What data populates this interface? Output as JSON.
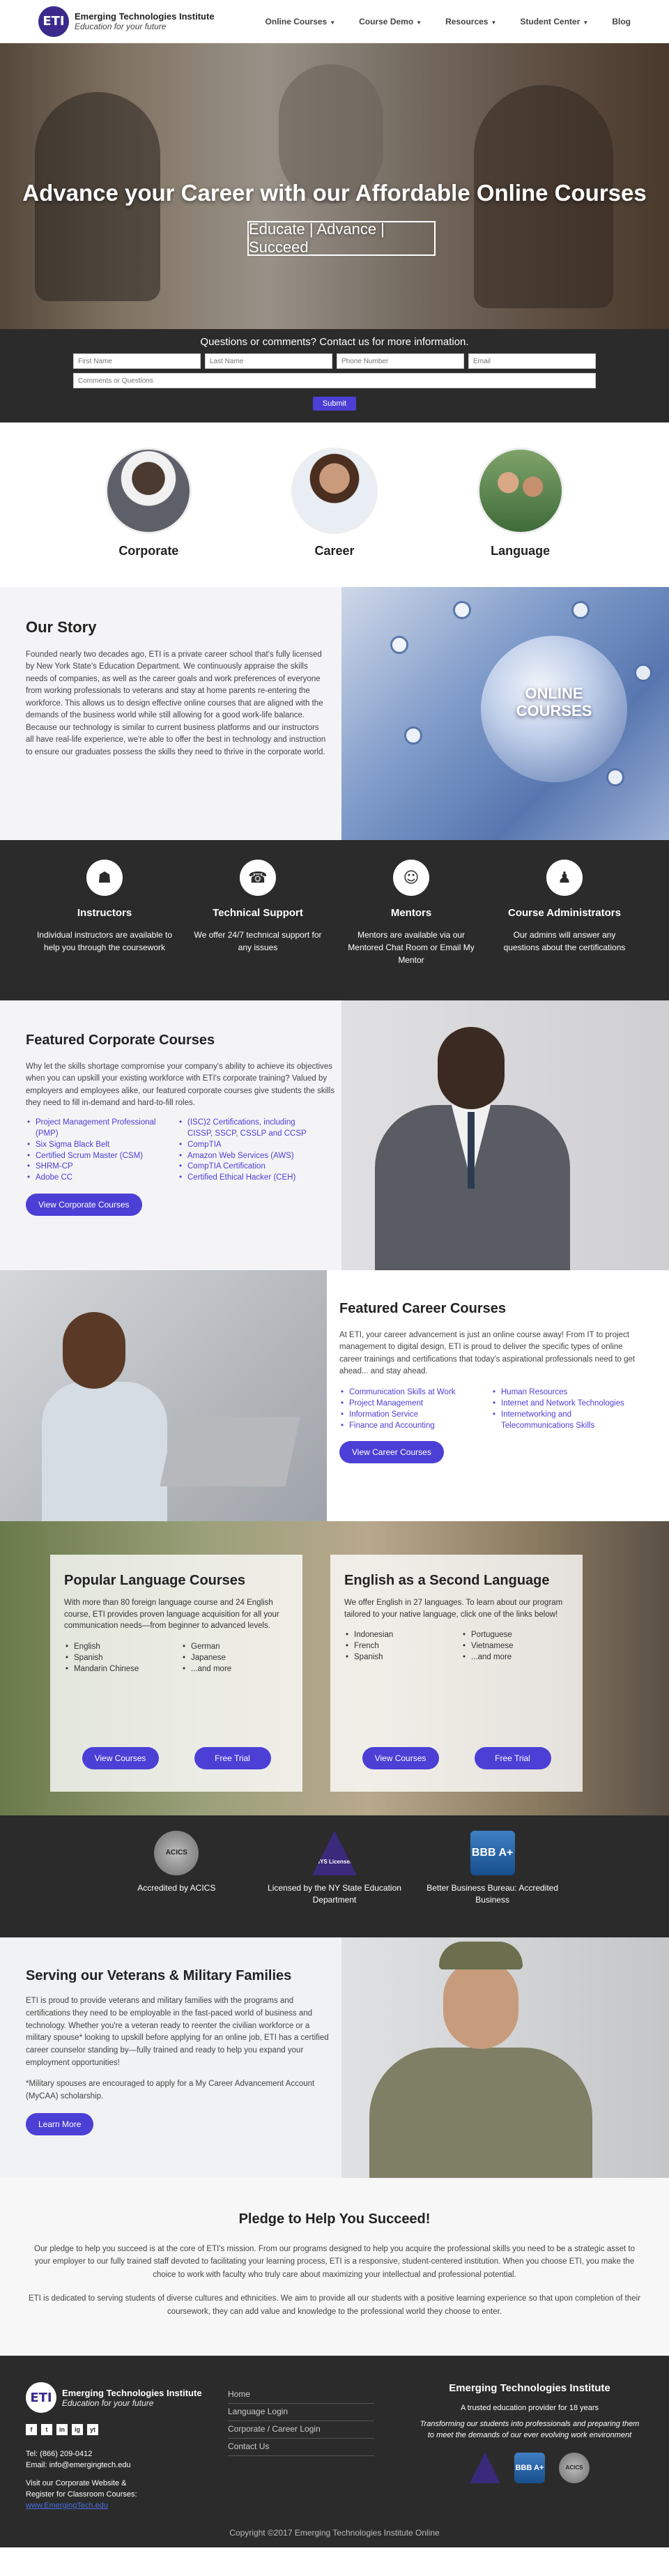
{
  "brand": {
    "name": "Emerging Technologies Institute",
    "tagline": "Education for your future",
    "logo_letters": "ETI"
  },
  "nav": {
    "items": [
      "Online Courses",
      "Course Demo",
      "Resources",
      "Student Center",
      "Blog"
    ]
  },
  "hero": {
    "title": "Advance your Career with our Affordable Online Courses",
    "subtitle": "Educate | Advance | Succeed"
  },
  "contact": {
    "heading": "Questions or comments? Contact us for more information.",
    "placeholders": {
      "first_name": "First Name",
      "last_name": "Last Name",
      "phone": "Phone Number",
      "email": "Email",
      "questions": "Comments or Questions"
    },
    "submit_label": "Submit"
  },
  "categories": [
    {
      "label": "Corporate"
    },
    {
      "label": "Career"
    },
    {
      "label": "Language"
    }
  ],
  "story": {
    "heading": "Our Story",
    "body": "Founded nearly two decades ago, ETI is a private career school that's fully licensed by New York State's Education Department. We continuously appraise the skills needs of companies, as well as the career goals and work preferences of everyone from working professionals to veterans and stay at home parents re-entering the workforce. This allows us to design effective online courses that are aligned with the demands of the business world while still allowing for a good work-life balance. Because our technology is similar to current business platforms and our instructors all have real-life experience, we're able to offer the best in technology and instruction to ensure our graduates possess the skills they need to thrive in the corporate world.",
    "image_text_1": "ONLINE",
    "image_text_2": "COURSES"
  },
  "support": [
    {
      "title": "Instructors",
      "text": "Individual instructors are available to help you through the coursework",
      "icon": "teacher-icon"
    },
    {
      "title": "Technical Support",
      "text": "We offer 24/7 technical support for any issues",
      "icon": "headset-icon"
    },
    {
      "title": "Mentors",
      "text": "Mentors are available via our Mentored Chat Room or Email My Mentor",
      "icon": "mentor-icon"
    },
    {
      "title": "Course Administrators",
      "text": "Our admins will answer any questions about the certifications",
      "icon": "admin-icon"
    }
  ],
  "corporate": {
    "heading": "Featured Corporate Courses",
    "body": "Why let the skills shortage compromise your company's ability to achieve its objectives when you can upskill your existing workforce with ETI's corporate training? Valued by employers and employees alike, our featured corporate courses give students the skills they need to fill in-demand and hard-to-fill roles.",
    "list_left": [
      "Project Management Professional (PMP)",
      "Six Sigma Black Belt",
      "Certified Scrum Master (CSM)",
      "SHRM-CP",
      "Adobe CC"
    ],
    "list_right": [
      "(ISC)2 Certifications, including CISSP, SSCP, CSSLP and CCSP",
      "CompTIA",
      "Amazon Web Services (AWS)",
      "CompTIA Certification",
      "Certified Ethical Hacker (CEH)"
    ],
    "button": "View Corporate Courses"
  },
  "career": {
    "heading": "Featured Career Courses",
    "body": "At ETI, your career advancement is just an online course away! From IT to project management to digital design, ETI is proud to deliver the specific types of online career trainings and certifications that today's aspirational professionals need to get ahead... and stay ahead.",
    "list_left": [
      "Communication Skills at Work",
      "Project Management",
      "Information Service",
      "Finance and Accounting"
    ],
    "list_right": [
      "Human Resources",
      "Internet and Network Technologies",
      "Internetworking and Telecommunications Skills"
    ],
    "button": "View Career Courses"
  },
  "language": {
    "popular": {
      "heading": "Popular Language Courses",
      "body": "With more than 80 foreign language course and 24 English course, ETI provides proven language acquisition for all your communication needs—from beginner to advanced levels.",
      "list_left": [
        "English",
        "Spanish",
        "Mandarin Chinese"
      ],
      "list_right": [
        "German",
        "Japanese",
        "...and more"
      ],
      "button_view": "View Courses",
      "button_trial": "Free Trial"
    },
    "esl": {
      "heading": "English as a Second Language",
      "body": "We offer English in 27 languages. To learn about our program tailored to your native language, click one of the links below!",
      "list_left": [
        "Indonesian",
        "French",
        "Spanish"
      ],
      "list_right": [
        "Portuguese",
        "Vietnamese",
        "...and more"
      ],
      "button_view": "View Courses",
      "button_trial": "Free Trial"
    }
  },
  "accreditations": [
    {
      "text": "Accredited by ACICS",
      "badge": "ACICS"
    },
    {
      "text": "Licensed by the NY State Education Department",
      "badge": "NYS Licensed"
    },
    {
      "text": "Better Business Bureau: Accredited Business",
      "badge": "BBB A+"
    }
  ],
  "veterans": {
    "heading": "Serving our Veterans & Military Families",
    "body": "ETI is proud to provide veterans and military families with the programs and certifications they need to be employable in the fast-paced world of business and technology. Whether you're a veteran ready to reenter the civilian workforce or a military spouse* looking to upskill before applying for an online job, ETI has a certified career counselor standing by—fully trained and ready to help you expand your employment opportunities!",
    "note": "*Military spouses are encouraged to apply for a My Career Advancement Account (MyCAA) scholarship.",
    "button": "Learn More"
  },
  "pledge": {
    "heading": "Pledge to Help You Succeed!",
    "p1": "Our pledge to help you succeed is at the core of ETI's mission. From our programs designed to help you acquire the professional skills you need to be a strategic asset to your employer to our fully trained staff devoted to facilitating your learning process, ETI is a responsive, student-centered institution. When you choose ETI, you make the choice to work with faculty who truly care about maximizing your intellectual and professional potential.",
    "p2": "ETI is dedicated to serving students of diverse cultures and ethnicities. We aim to provide all our students with a positive learning experience so that upon completion of their coursework, they can add value and knowledge to the professional world they choose to enter."
  },
  "footer": {
    "phone": "Tel: (866) 209-0412",
    "email": "Email: info@emergingtech.edu",
    "visit": "Visit our Corporate Website &",
    "register": "Register for Classroom Courses:",
    "url": "www.EmergingTech.edu",
    "links": [
      "Home",
      "Language Login",
      "Corporate / Career Login",
      "Contact Us"
    ],
    "org_name": "Emerging Technologies Institute",
    "trust": "A trusted education provider for 18 years",
    "motto": "Transforming our students into professionals and preparing them to meet the demands of our ever evolving work environment",
    "socials": [
      "f",
      "t",
      "in",
      "ig",
      "yt"
    ],
    "copyright": "Copyright ©2017 Emerging Technologies Institute Online"
  }
}
